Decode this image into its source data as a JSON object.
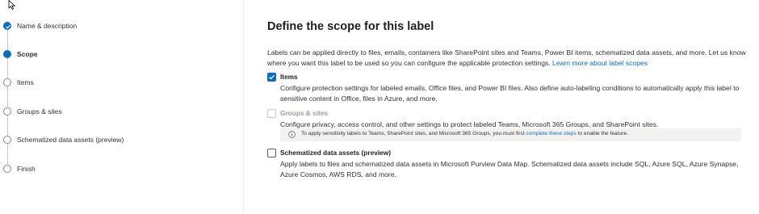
{
  "stepper": {
    "steps": [
      {
        "label": "Name & description",
        "state": "done"
      },
      {
        "label": "Scope",
        "state": "active"
      },
      {
        "label": "Items",
        "state": "todo"
      },
      {
        "label": "Groups & sites",
        "state": "todo"
      },
      {
        "label": "Schematized data assets (preview)",
        "state": "todo"
      },
      {
        "label": "Finish",
        "state": "todo"
      }
    ]
  },
  "main": {
    "title": "Define the scope for this label",
    "intro_text": "Labels can be applied directly to files, emails, containers like SharePoint sites and Teams, Power BI items, schematized data assets, and more. Let us know where you want this label to be used so you can configure the applicable protection settings. ",
    "intro_link": "Learn more about label scopes",
    "options": [
      {
        "label": "Items",
        "checked": true,
        "disabled": false,
        "description": "Configure protection settings for labeled emails, Office files, and Power BI files. Also define auto-labeling conditions to automatically apply this label to sensitive content in Office, files in Azure, and more."
      },
      {
        "label": "Groups & sites",
        "checked": false,
        "disabled": true,
        "description": "Configure privacy, access control, and other settings to protect labeled Teams, Microsoft 365 Groups, and SharePoint sites."
      },
      {
        "label": "Schematized data assets (preview)",
        "checked": false,
        "disabled": false,
        "description": "Apply labels to files and schematized data assets in Microsoft Purview Data Map. Schematized data assets include SQL, Azure SQL, Azure Synapse, Azure Cosmos, AWS RDS, and more."
      }
    ],
    "info": {
      "text_before": "To apply sensitivity labels to Teams, SharePoint sites, and Microsoft 365 Groups, you must first ",
      "link": "complete these steps",
      "text_after": " to enable the feature."
    }
  },
  "colors": {
    "accent": "#0f6cbd",
    "disabled_text": "#a19f9d",
    "info_bar_bg": "#f3f2f1"
  }
}
